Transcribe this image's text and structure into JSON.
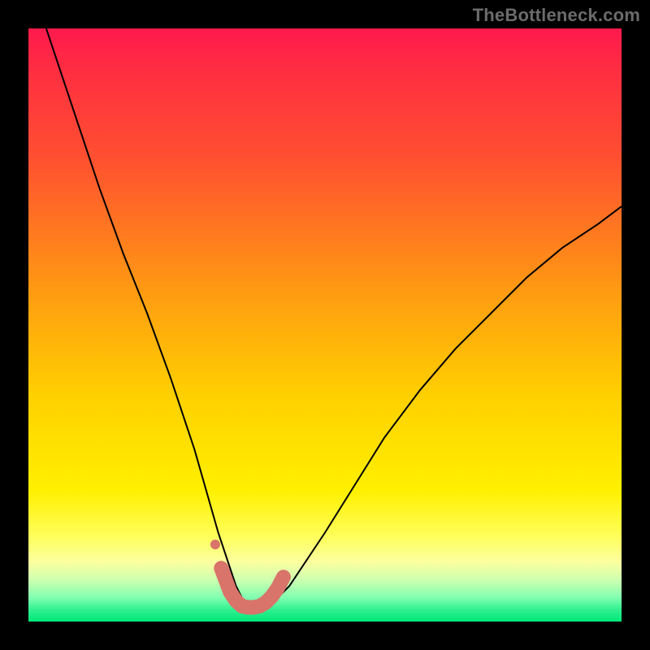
{
  "watermark": "TheBottleneck.com",
  "chart_data": {
    "type": "line",
    "title": "",
    "xlabel": "",
    "ylabel": "",
    "xlim": [
      0,
      100
    ],
    "ylim": [
      0,
      100
    ],
    "grid": false,
    "legend": false,
    "series": [
      {
        "name": "curve",
        "color": "#000000",
        "stroke_width": 2,
        "x": [
          3,
          8,
          12,
          16,
          20,
          24,
          28,
          30,
          32,
          34,
          35,
          36,
          37,
          38,
          39,
          40,
          42,
          44,
          46,
          50,
          55,
          60,
          66,
          72,
          78,
          84,
          90,
          96,
          100
        ],
        "y": [
          100,
          85,
          73,
          62,
          52,
          41,
          29,
          22,
          15,
          9,
          6,
          4,
          3,
          2.5,
          2.5,
          3,
          4,
          6,
          9,
          15,
          23,
          31,
          39,
          46,
          52,
          58,
          63,
          67,
          70
        ]
      },
      {
        "name": "bottom-marker",
        "color": "#d9746a",
        "stroke_width": 18,
        "x": [
          32.5,
          34,
          35,
          36,
          37,
          38,
          39,
          40,
          41,
          42,
          43
        ],
        "y": [
          9,
          5,
          3.5,
          2.6,
          2.4,
          2.4,
          2.6,
          3.2,
          4.2,
          5.6,
          7.5
        ]
      },
      {
        "name": "dot",
        "type": "scatter",
        "color": "#d9746a",
        "radius": 6,
        "x": [
          31.5
        ],
        "y": [
          13
        ]
      }
    ]
  }
}
